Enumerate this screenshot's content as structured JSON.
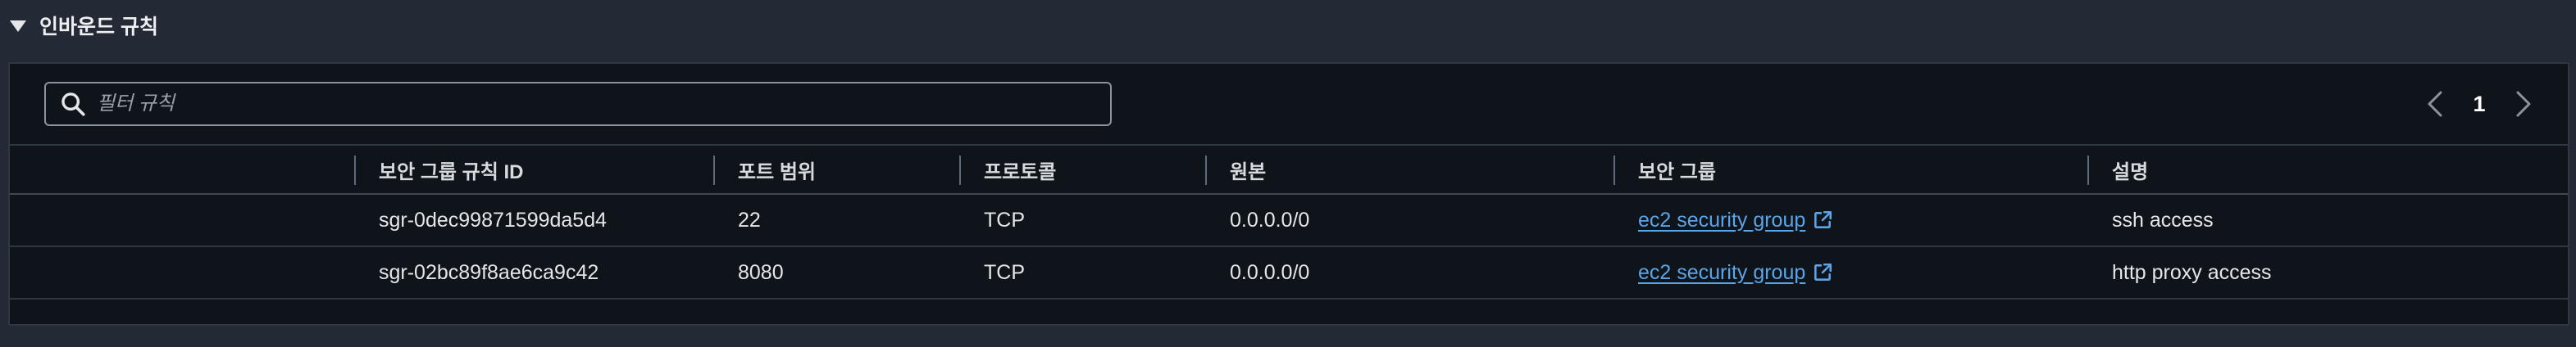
{
  "section": {
    "title": "인바운드 규칙"
  },
  "search": {
    "placeholder": "필터 규칙",
    "value": ""
  },
  "pagination": {
    "current_page": "1"
  },
  "table": {
    "columns": [
      "",
      "보안 그룹 규칙 ID",
      "포트 범위",
      "프로토콜",
      "원본",
      "보안 그룹",
      "설명"
    ],
    "rows": [
      {
        "rule_id": "sgr-0dec99871599da5d4",
        "port_range": "22",
        "protocol": "TCP",
        "source": "0.0.0.0/0",
        "security_group": "ec2 security group",
        "description": "ssh access"
      },
      {
        "rule_id": "sgr-02bc89f8ae6ca9c42",
        "port_range": "8080",
        "protocol": "TCP",
        "source": "0.0.0.0/0",
        "security_group": "ec2 security group",
        "description": "http proxy access"
      }
    ]
  },
  "colors": {
    "background": "#232a35",
    "panel": "#0f141b",
    "link": "#5aa4e8",
    "text": "#e3e6ea"
  },
  "icons": [
    "caret-down-icon",
    "search-icon",
    "chevron-left-icon",
    "chevron-right-icon",
    "external-link-icon"
  ]
}
